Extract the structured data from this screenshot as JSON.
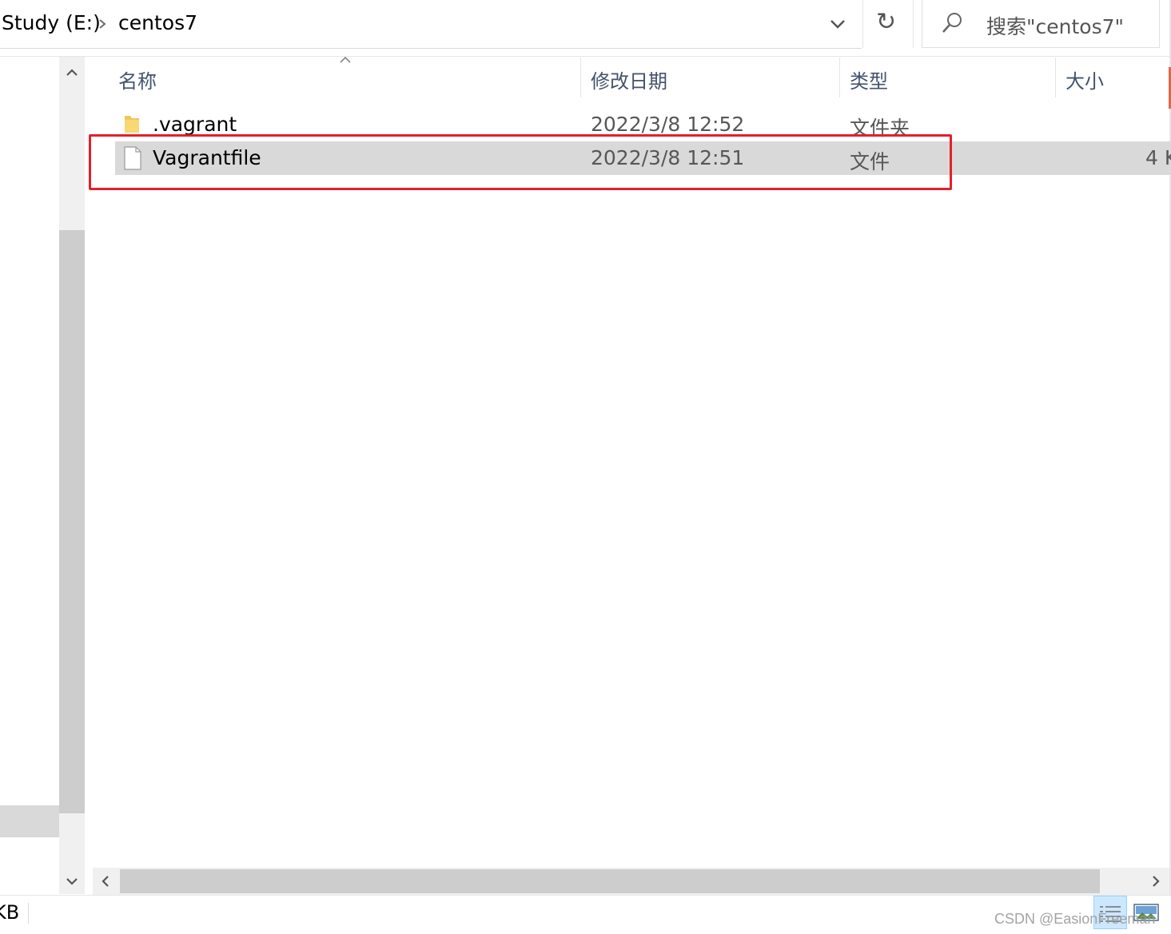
{
  "address_bar": {
    "breadcrumbs": [
      "Study (E:)",
      "centos7"
    ],
    "search_placeholder": "搜索\"centos7\""
  },
  "columns": [
    "名称",
    "修改日期",
    "类型",
    "大小"
  ],
  "files": [
    {
      "name": ".vagrant",
      "modified": "2022/3/8 12:52",
      "type": "文件夹",
      "size": "",
      "icon": "folder-icon",
      "selected": false
    },
    {
      "name": "Vagrantfile",
      "modified": "2022/3/8 12:51",
      "type": "文件",
      "size": "4 K",
      "icon": "file-icon",
      "selected": true
    }
  ],
  "status_bar": {
    "text": "KB"
  },
  "watermark": "CSDN @EasionFreeman",
  "colors": {
    "highlight_box": "#e3202b",
    "selected_row": "#d9d9d9",
    "header_text": "#43536b",
    "folder": "#f2c55c"
  }
}
